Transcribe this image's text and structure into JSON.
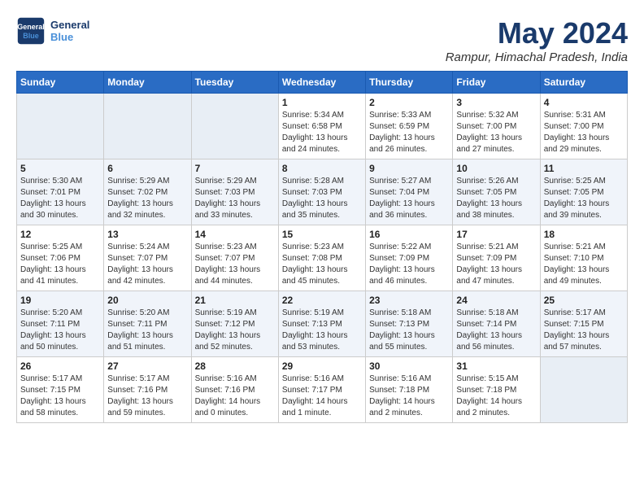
{
  "header": {
    "logo_line1": "General",
    "logo_line2": "Blue",
    "month_title": "May 2024",
    "location": "Rampur, Himachal Pradesh, India"
  },
  "days_of_week": [
    "Sunday",
    "Monday",
    "Tuesday",
    "Wednesday",
    "Thursday",
    "Friday",
    "Saturday"
  ],
  "weeks": [
    [
      {
        "day": "",
        "info": ""
      },
      {
        "day": "",
        "info": ""
      },
      {
        "day": "",
        "info": ""
      },
      {
        "day": "1",
        "info": "Sunrise: 5:34 AM\nSunset: 6:58 PM\nDaylight: 13 hours\nand 24 minutes."
      },
      {
        "day": "2",
        "info": "Sunrise: 5:33 AM\nSunset: 6:59 PM\nDaylight: 13 hours\nand 26 minutes."
      },
      {
        "day": "3",
        "info": "Sunrise: 5:32 AM\nSunset: 7:00 PM\nDaylight: 13 hours\nand 27 minutes."
      },
      {
        "day": "4",
        "info": "Sunrise: 5:31 AM\nSunset: 7:00 PM\nDaylight: 13 hours\nand 29 minutes."
      }
    ],
    [
      {
        "day": "5",
        "info": "Sunrise: 5:30 AM\nSunset: 7:01 PM\nDaylight: 13 hours\nand 30 minutes."
      },
      {
        "day": "6",
        "info": "Sunrise: 5:29 AM\nSunset: 7:02 PM\nDaylight: 13 hours\nand 32 minutes."
      },
      {
        "day": "7",
        "info": "Sunrise: 5:29 AM\nSunset: 7:03 PM\nDaylight: 13 hours\nand 33 minutes."
      },
      {
        "day": "8",
        "info": "Sunrise: 5:28 AM\nSunset: 7:03 PM\nDaylight: 13 hours\nand 35 minutes."
      },
      {
        "day": "9",
        "info": "Sunrise: 5:27 AM\nSunset: 7:04 PM\nDaylight: 13 hours\nand 36 minutes."
      },
      {
        "day": "10",
        "info": "Sunrise: 5:26 AM\nSunset: 7:05 PM\nDaylight: 13 hours\nand 38 minutes."
      },
      {
        "day": "11",
        "info": "Sunrise: 5:25 AM\nSunset: 7:05 PM\nDaylight: 13 hours\nand 39 minutes."
      }
    ],
    [
      {
        "day": "12",
        "info": "Sunrise: 5:25 AM\nSunset: 7:06 PM\nDaylight: 13 hours\nand 41 minutes."
      },
      {
        "day": "13",
        "info": "Sunrise: 5:24 AM\nSunset: 7:07 PM\nDaylight: 13 hours\nand 42 minutes."
      },
      {
        "day": "14",
        "info": "Sunrise: 5:23 AM\nSunset: 7:07 PM\nDaylight: 13 hours\nand 44 minutes."
      },
      {
        "day": "15",
        "info": "Sunrise: 5:23 AM\nSunset: 7:08 PM\nDaylight: 13 hours\nand 45 minutes."
      },
      {
        "day": "16",
        "info": "Sunrise: 5:22 AM\nSunset: 7:09 PM\nDaylight: 13 hours\nand 46 minutes."
      },
      {
        "day": "17",
        "info": "Sunrise: 5:21 AM\nSunset: 7:09 PM\nDaylight: 13 hours\nand 47 minutes."
      },
      {
        "day": "18",
        "info": "Sunrise: 5:21 AM\nSunset: 7:10 PM\nDaylight: 13 hours\nand 49 minutes."
      }
    ],
    [
      {
        "day": "19",
        "info": "Sunrise: 5:20 AM\nSunset: 7:11 PM\nDaylight: 13 hours\nand 50 minutes."
      },
      {
        "day": "20",
        "info": "Sunrise: 5:20 AM\nSunset: 7:11 PM\nDaylight: 13 hours\nand 51 minutes."
      },
      {
        "day": "21",
        "info": "Sunrise: 5:19 AM\nSunset: 7:12 PM\nDaylight: 13 hours\nand 52 minutes."
      },
      {
        "day": "22",
        "info": "Sunrise: 5:19 AM\nSunset: 7:13 PM\nDaylight: 13 hours\nand 53 minutes."
      },
      {
        "day": "23",
        "info": "Sunrise: 5:18 AM\nSunset: 7:13 PM\nDaylight: 13 hours\nand 55 minutes."
      },
      {
        "day": "24",
        "info": "Sunrise: 5:18 AM\nSunset: 7:14 PM\nDaylight: 13 hours\nand 56 minutes."
      },
      {
        "day": "25",
        "info": "Sunrise: 5:17 AM\nSunset: 7:15 PM\nDaylight: 13 hours\nand 57 minutes."
      }
    ],
    [
      {
        "day": "26",
        "info": "Sunrise: 5:17 AM\nSunset: 7:15 PM\nDaylight: 13 hours\nand 58 minutes."
      },
      {
        "day": "27",
        "info": "Sunrise: 5:17 AM\nSunset: 7:16 PM\nDaylight: 13 hours\nand 59 minutes."
      },
      {
        "day": "28",
        "info": "Sunrise: 5:16 AM\nSunset: 7:16 PM\nDaylight: 14 hours\nand 0 minutes."
      },
      {
        "day": "29",
        "info": "Sunrise: 5:16 AM\nSunset: 7:17 PM\nDaylight: 14 hours\nand 1 minute."
      },
      {
        "day": "30",
        "info": "Sunrise: 5:16 AM\nSunset: 7:18 PM\nDaylight: 14 hours\nand 2 minutes."
      },
      {
        "day": "31",
        "info": "Sunrise: 5:15 AM\nSunset: 7:18 PM\nDaylight: 14 hours\nand 2 minutes."
      },
      {
        "day": "",
        "info": ""
      }
    ]
  ]
}
